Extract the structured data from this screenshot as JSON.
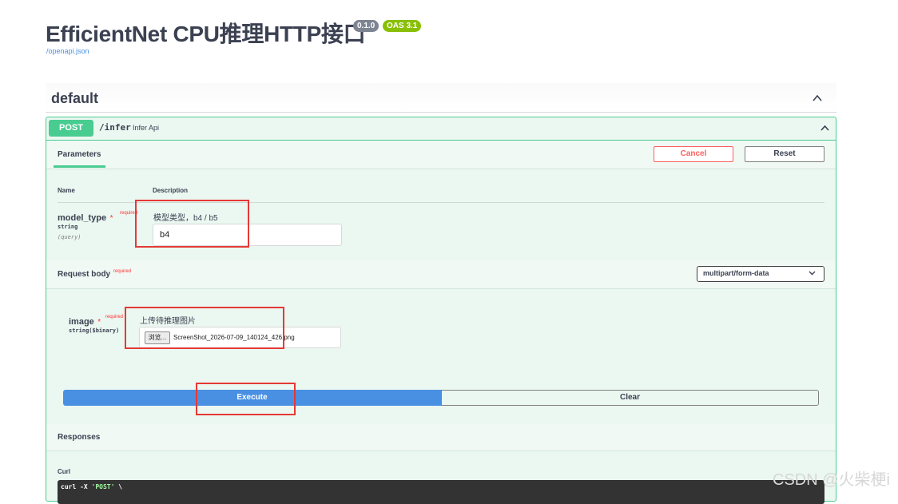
{
  "header": {
    "title": "EfficientNet CPU推理HTTP接口",
    "version_badge": "0.1.0",
    "oas_badge": "OAS 3.1",
    "openapi_link": "/openapi.json"
  },
  "tag": {
    "name": "default"
  },
  "operation": {
    "method": "POST",
    "path": "/infer",
    "summary": "Infer Api"
  },
  "parameters": {
    "tab_label": "Parameters",
    "cancel_label": "Cancel",
    "reset_label": "Reset",
    "col_name": "Name",
    "col_description": "Description",
    "items": [
      {
        "name": "model_type",
        "star": "*",
        "required": "required",
        "type": "string",
        "location": "(query)",
        "description": "模型类型，b4 / b5",
        "value": "b4"
      }
    ]
  },
  "request_body": {
    "title": "Request body",
    "required": "required",
    "content_type": "multipart/form-data",
    "field": {
      "name": "image",
      "star": "*",
      "required": "required",
      "type": "string($binary)",
      "description": "上传待推理图片",
      "browse_label": "浏览...",
      "file_name": "ScreenShot_2026-07-09_140124_426.png"
    }
  },
  "actions": {
    "execute_label": "Execute",
    "clear_label": "Clear"
  },
  "responses": {
    "title": "Responses",
    "curl_label": "Curl",
    "curl_prefix": "curl -X ",
    "curl_method": "'POST'",
    "curl_suffix": " \\"
  },
  "watermark": "CSDN @火柴梗i",
  "colors": {
    "post_green": "#49cc90",
    "execute_blue": "#4990e2",
    "cancel_red": "#ff6060",
    "annotation_red": "#e53935"
  },
  "icons": {
    "tag_toggle": "chevron-up-icon",
    "op_toggle": "chevron-up-icon",
    "select_toggle": "chevron-down-icon"
  }
}
